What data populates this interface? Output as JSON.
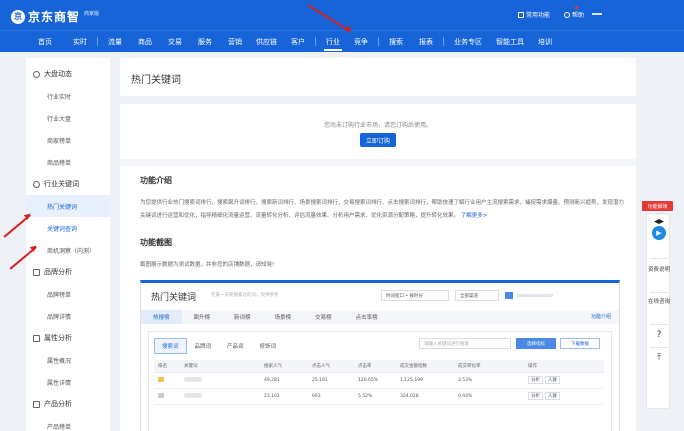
{
  "header": {
    "logo_text": "京东商智",
    "logo_badge": "商家版",
    "top_links": [
      "常用功能",
      "帮助"
    ]
  },
  "nav": {
    "items": [
      "首页",
      "实时",
      "流量",
      "商品",
      "交易",
      "服务",
      "营销",
      "供应链",
      "客户",
      "行业",
      "竞争",
      "搜索",
      "报表",
      "业务专区",
      "智能工具",
      "培训"
    ],
    "active": "行业"
  },
  "sidebar": {
    "sections": [
      {
        "title": "大盘动态",
        "items": [
          "行业实时",
          "行业大盘",
          "商家榜单",
          "商品榜单"
        ]
      },
      {
        "title": "行业关键词",
        "items": [
          "热门关键词",
          "关键词查询",
          "商机洞察（内测）"
        ]
      },
      {
        "title": "品牌分析",
        "items": [
          "品牌榜单",
          "品牌详情"
        ]
      },
      {
        "title": "属性分析",
        "items": [
          "属性概况",
          "属性详情"
        ]
      },
      {
        "title": "产品分析",
        "items": [
          "产品榜单"
        ]
      }
    ],
    "active_item": "热门关键词"
  },
  "page": {
    "title": "热门关键词",
    "notice": "您尚未订购行业市场，请您订购后使用。",
    "order_button": "立即订购",
    "intro_title": "功能介绍",
    "intro_text": "为您提供行业热门搜索词排行、搜索飙升词排行、搜索新词排行、场景搜索词排行、交易搜索词排行、点击搜索词排行，帮助快速了解行业用户主流搜索需求，捕捉需求爆量、预测新兴趋势，发现潜力关键词进行运营和优化，指导精细化流量运营、流量转化分析、评估流量效果、分析用户需求、优化资源分配策略，提升转化效果。",
    "intro_more": "了解更多>",
    "screenshot_title": "功能截图",
    "screenshot_note": "截图展示数据为测试数据，并非您的店铺数据，请知晓!"
  },
  "screenshot": {
    "title": "热门关键词",
    "search_hint": "在某一天新搜索过的词，仅供参考",
    "selects": [
      "时间窗口 • 按时长",
      "全部渠道"
    ],
    "tabs": [
      "热搜榜",
      "飙升榜",
      "新词榜",
      "场景榜",
      "交易榜",
      "点击率榜"
    ],
    "config_link": "功能介绍",
    "sub_tabs": [
      "搜索词",
      "品牌词",
      "产品词",
      "修饰词"
    ],
    "sub_search_placeholder": "请输入关键词进行搜索",
    "btn_indicator": "选择指标",
    "btn_download": "下载数据",
    "columns": [
      "排名",
      "关键词",
      "搜索人气",
      "点击人气",
      "点击率",
      "成交金额指数",
      "成交转化率",
      "",
      "操作"
    ],
    "rows": [
      {
        "search": "49,281",
        "click": "25,191",
        "ctr": "120.65%",
        "gmv": "1,125,199",
        "cvr": "3.53%",
        "ops": [
          "分析",
          "人群"
        ]
      },
      {
        "search": "23,102",
        "click": "663",
        "ctr": "5.52%",
        "gmv": "324,028",
        "cvr": "0.44%",
        "ops": [
          "分析",
          "人群"
        ]
      }
    ]
  },
  "float_bar": {
    "tag": "功能解读",
    "items": [
      "资费说明",
      "在线咨询"
    ],
    "icons": [
      "grad-cap-icon",
      "back-to-top-icon"
    ],
    "colors": {
      "brand": "#1664d8",
      "alert": "#e53935"
    }
  }
}
